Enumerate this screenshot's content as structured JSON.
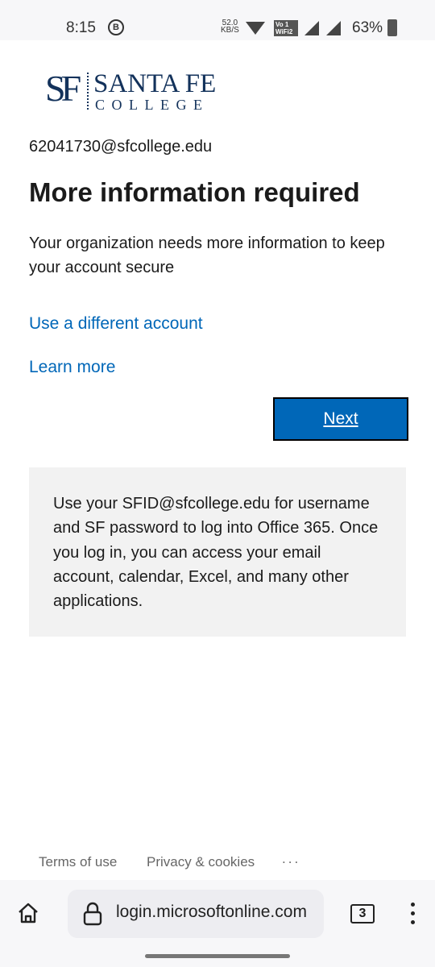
{
  "status_bar": {
    "time": "8:15",
    "notification_badge": "B",
    "speed_value": "52.0",
    "speed_unit": "KB/S",
    "vowifi_top": "Vo 1",
    "vowifi_bottom": "WiFi2",
    "battery": "63%"
  },
  "logo": {
    "initials": "SF",
    "name": "SANTA FE",
    "subtitle": "COLLEGE",
    "color": "#13325b"
  },
  "account_email": "62041730@sfcollege.edu",
  "title": "More information required",
  "description": "Your organization needs more information to keep your account secure",
  "links": {
    "different_account": "Use a different account",
    "learn_more": "Learn more"
  },
  "next_button": "Next",
  "info_box": "Use your SFID@sfcollege.edu for username and SF password to log into Office 365. Once you log in, you can access your email account, calendar, Excel, and many other applications.",
  "footer": {
    "terms": "Terms of use",
    "privacy": "Privacy & cookies",
    "more": "..."
  },
  "browser": {
    "url": "login.microsoftonline.com",
    "tab_count": "3"
  },
  "colors": {
    "accent": "#0067b8",
    "info_bg": "#f2f2f2"
  }
}
